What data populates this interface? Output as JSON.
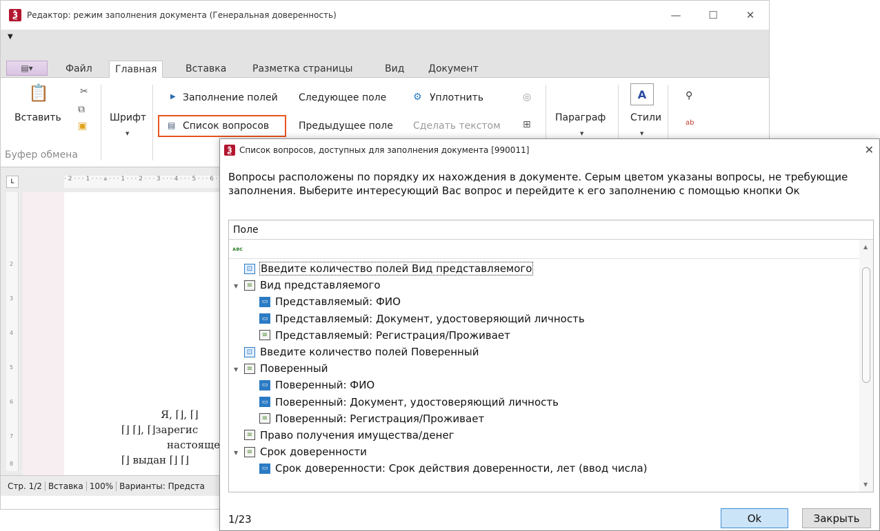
{
  "window": {
    "title": "Редактор: режим заполнения документа (Генеральная доверенность)",
    "icon": "app-logo-icon",
    "controls": [
      "_",
      "□",
      "✕"
    ]
  },
  "ribbon": {
    "tabs": [
      "Файл",
      "Главная",
      "Вставка",
      "Разметка страницы",
      "Вид",
      "Документ"
    ],
    "active_tab": "Главная",
    "clipboard": {
      "paste": "Вставить",
      "caption": "Буфер обмена"
    },
    "font": "Шрифт",
    "fill": {
      "fill_fields": "Заполнение полей",
      "next_field": "Следующее поле",
      "compact": "Уплотнить",
      "questions_list": "Список вопросов",
      "prev_field": "Предыдущее поле",
      "make_text": "Сделать текстом"
    },
    "paragraph": "Параграф",
    "styles": "Стили"
  },
  "document": {
    "lines": [
      "Я, ⌈⌋, ⌈⌋",
      "⌈⌋ ⌈⌋, ⌈⌋зарегис",
      "настояще",
      "⌈⌋ выдан ⌈⌋ ⌈⌋"
    ]
  },
  "statusbar": {
    "page": "Стр. 1/2",
    "mode": "Вставка",
    "zoom": "100%",
    "variants": "Варианты: Предста"
  },
  "dialog": {
    "title": "Список вопросов, доступных для заполнения документа [990011]",
    "description": "Вопросы расположены по порядку их нахождения в документе. Серым цветом указаны вопросы, не требующие заполнения. Выберите интересующий Вас вопрос и перейдите к его заполнению с помощью кнопки Ок",
    "column_header": "Поле",
    "rows": [
      {
        "label": "Введите количество полей Вид представляемого",
        "level": 0,
        "icon": "fields-count",
        "expander": false,
        "selected": true
      },
      {
        "label": "Вид представляемого",
        "level": 0,
        "icon": "group",
        "expander": true
      },
      {
        "label": "Представляемый: ФИО",
        "level": 1,
        "icon": "input",
        "expander": false
      },
      {
        "label": "Представляемый: Документ, удостоверяющий личность",
        "level": 1,
        "icon": "input",
        "expander": false
      },
      {
        "label": "Представляемый: Регистрация/Проживает",
        "level": 1,
        "icon": "group",
        "expander": false
      },
      {
        "label": "Введите количество полей Поверенный",
        "level": 0,
        "icon": "fields-count",
        "expander": false
      },
      {
        "label": "Поверенный",
        "level": 0,
        "icon": "group",
        "expander": true
      },
      {
        "label": "Поверенный: ФИО",
        "level": 1,
        "icon": "input",
        "expander": false
      },
      {
        "label": "Поверенный: Документ, удостоверяющий личность",
        "level": 1,
        "icon": "input",
        "expander": false
      },
      {
        "label": "Поверенный: Регистрация/Проживает",
        "level": 1,
        "icon": "group",
        "expander": false
      },
      {
        "label": "Право получения имущества/денег",
        "level": 0,
        "icon": "group",
        "expander": false
      },
      {
        "label": "Срок доверенности",
        "level": 0,
        "icon": "group",
        "expander": true
      },
      {
        "label": "Срок доверенности: Срок действия доверенности, лет (ввод числа)",
        "level": 1,
        "icon": "input",
        "expander": false
      }
    ],
    "counter": "1/23",
    "ok": "Ok",
    "close": "Закрыть"
  },
  "colors": {
    "highlight": "#e8541e",
    "brand": "#b3162f",
    "ok_button": "#cce4f7"
  }
}
